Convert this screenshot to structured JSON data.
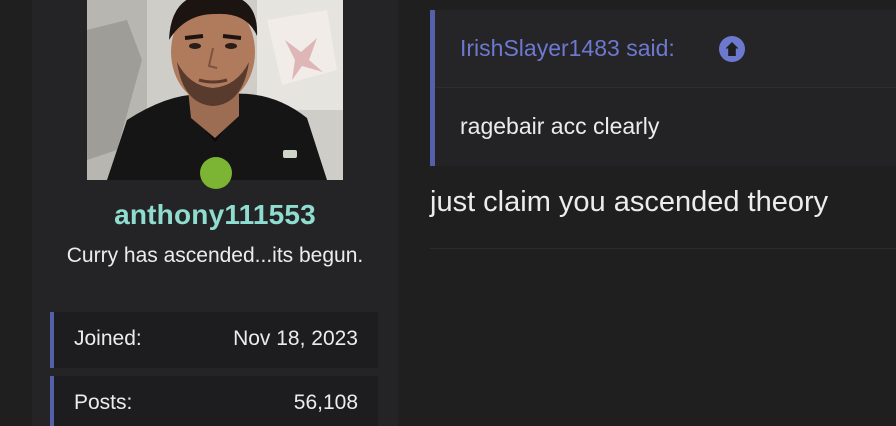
{
  "user": {
    "username": "anthony111553",
    "title": "Curry has ascended...its begun.",
    "online": true,
    "stats": [
      {
        "label": "Joined:",
        "value": "Nov 18, 2023"
      },
      {
        "label": "Posts:",
        "value": "56,108"
      }
    ]
  },
  "post": {
    "quote": {
      "author_line": "IrishSlayer1483 said:",
      "jump_icon": "arrow-up-circle-icon",
      "text": "ragebair acc clearly"
    },
    "body": "just claim you ascended theory"
  },
  "colors": {
    "background": "#1f1f20",
    "username": "#8fdcd0",
    "accent": "#6d79cf",
    "quote_border": "#5460a8",
    "online": "#7cb433"
  }
}
